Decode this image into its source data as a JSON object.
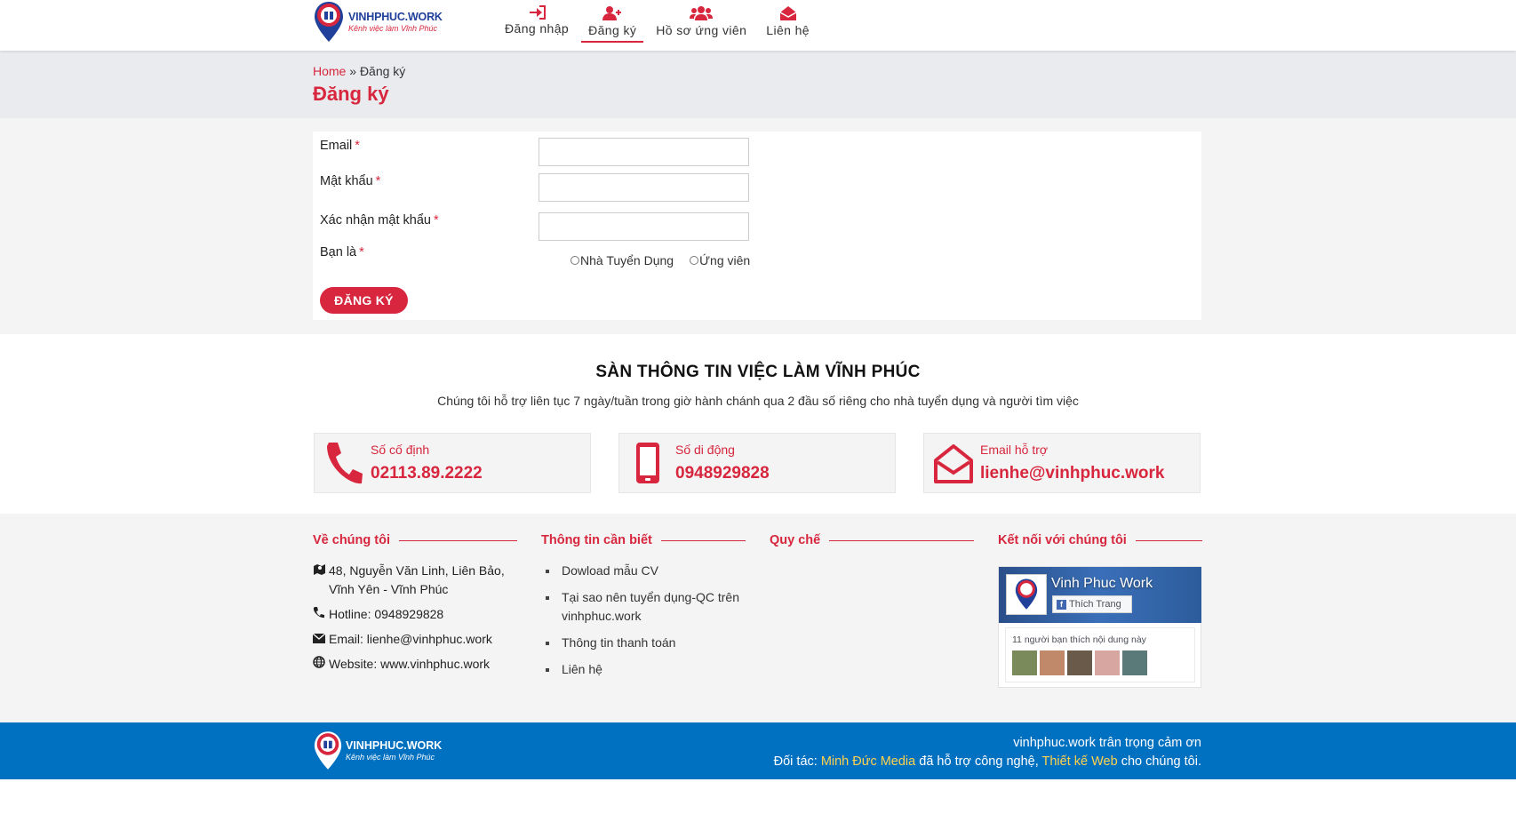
{
  "brand": {
    "name": "VINHPHUC.WORK",
    "tagline": "Kênh việc làm Vĩnh Phúc",
    "primary_color": "#d7263d",
    "secondary_color": "#21409a"
  },
  "nav": {
    "items": [
      {
        "label": "Đăng nhập",
        "icon": "sign-in-icon",
        "active": false
      },
      {
        "label": "Đăng ký",
        "icon": "user-plus-icon",
        "active": true
      },
      {
        "label": "Hồ sơ ứng viên",
        "icon": "users-icon",
        "active": false
      },
      {
        "label": "Liên hệ",
        "icon": "envelope-open-icon",
        "active": false
      }
    ]
  },
  "breadcrumb": {
    "home": "Home",
    "separator": "»",
    "current": "Đăng ký"
  },
  "page_title": "Đăng ký",
  "form": {
    "email_label": "Email",
    "password_label": "Mật khẩu",
    "confirm_label": "Xác nhận mật khẩu",
    "role_label": "Bạn là",
    "required_mark": "*",
    "email_value": "",
    "password_value": "",
    "confirm_value": "",
    "role_options": [
      "Nhà Tuyển Dụng",
      "Ứng viên"
    ],
    "submit_label": "ĐĂNG KÝ"
  },
  "contact": {
    "title": "SÀN THÔNG TIN VIỆC LÀM VĨNH PHÚC",
    "description": "Chúng tôi hỗ trợ liên tục 7 ngày/tuần trong giờ hành chánh qua 2 đầu số riêng cho nhà tuyển dụng và người tìm việc",
    "boxes": [
      {
        "label": "Số cố định",
        "value": "02113.89.2222",
        "icon": "phone-icon"
      },
      {
        "label": "Số di động",
        "value": "0948929828",
        "icon": "mobile-icon"
      },
      {
        "label": "Email hỗ trợ",
        "value": "lienhe@vinhphuc.work",
        "icon": "envelope-open-icon"
      }
    ]
  },
  "footer": {
    "about": {
      "heading": "Về chúng tôi",
      "address": "48, Nguyễn Văn Linh, Liên Bảo, Vĩnh Yên - Vĩnh Phúc",
      "hotline": "Hotline: 0948929828",
      "email": "Email: lienhe@vinhphuc.work",
      "website": "Website: www.vinhphuc.work"
    },
    "info": {
      "heading": "Thông tin cần biết",
      "links": [
        "Dowload mẫu CV",
        "Tại sao nên tuyển dụng-QC trên vinhphuc.work",
        "Thông tin thanh toán",
        "Liên hệ"
      ]
    },
    "rules": {
      "heading": "Quy chế"
    },
    "connect": {
      "heading": "Kết nối với chúng tôi",
      "page_name": "Vinh Phuc Work",
      "like_label": "Thích Trang",
      "friends_text": "11 người bạn thích nội dung này"
    }
  },
  "bottom": {
    "thanks": "vinhphuc.work trân trọng cảm ơn",
    "partner_prefix": "Đối tác: ",
    "partner1": "Minh Đức Media",
    "partner_mid": " đã hỗ trợ công nghệ, ",
    "partner2": "Thiết kế Web",
    "partner_suffix": " cho chúng tôi."
  }
}
